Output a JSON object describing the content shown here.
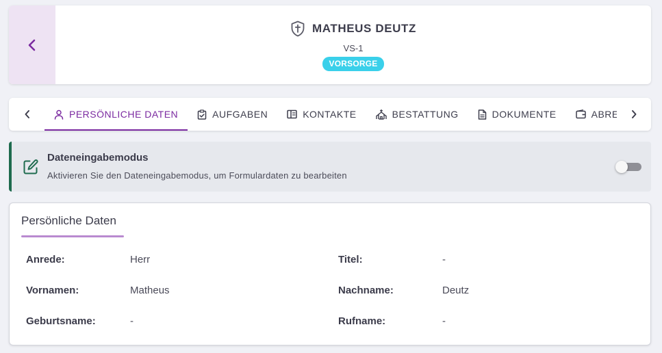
{
  "header": {
    "title": "MATHEUS DEUTZ",
    "case_id": "VS-1",
    "status_badge": "VORSORGE",
    "icon": "shield-cross-icon"
  },
  "tabs": [
    {
      "label": "PERSÖNLICHE DATEN",
      "icon": "person-icon",
      "active": true
    },
    {
      "label": "AUFGABEN",
      "icon": "clipboard-check-icon",
      "active": false
    },
    {
      "label": "KONTAKTE",
      "icon": "contact-book-icon",
      "active": false
    },
    {
      "label": "BESTATTUNG",
      "icon": "chapel-icon",
      "active": false
    },
    {
      "label": "DOKUMENTE",
      "icon": "document-icon",
      "active": false
    },
    {
      "label": "ABRECHNUNG",
      "icon": "wallet-icon",
      "active": false
    }
  ],
  "mode_banner": {
    "title": "Dateneingabemodus",
    "description": "Aktivieren Sie den Dateneingabemodus, um Formulardaten zu bearbeiten",
    "enabled": false
  },
  "personal_data": {
    "title": "Persönliche Daten",
    "fields": {
      "anrede": {
        "label": "Anrede:",
        "value": "Herr"
      },
      "titel": {
        "label": "Titel:",
        "value": "-"
      },
      "vornamen": {
        "label": "Vornamen:",
        "value": "Matheus"
      },
      "nachname": {
        "label": "Nachname:",
        "value": "Deutz"
      },
      "geburtsname": {
        "label": "Geburtsname:",
        "value": "-"
      },
      "rufname": {
        "label": "Rufname:",
        "value": "-"
      }
    }
  },
  "colors": {
    "accent": "#7b2aa0",
    "badge": "#3ad0ea",
    "banner_border": "#1e6b4e",
    "underline": "#b98ad0"
  }
}
